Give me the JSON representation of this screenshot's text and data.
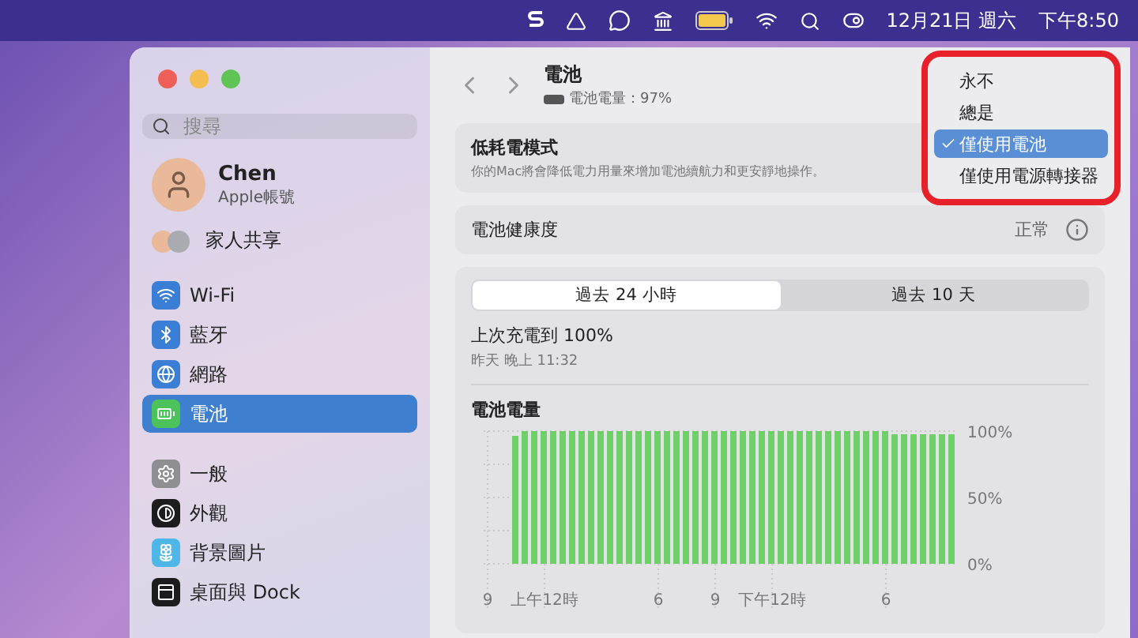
{
  "menu_bar": {
    "icons": [
      {
        "kind": "s"
      },
      {
        "kind": "drive"
      },
      {
        "kind": "line"
      },
      {
        "kind": "bank"
      },
      {
        "kind": "battery"
      },
      {
        "kind": "wifi"
      },
      {
        "kind": "search"
      },
      {
        "kind": "control"
      }
    ],
    "date": "12月21日 週六",
    "time": "下午8:50"
  },
  "sidebar": {
    "search": {
      "placeholder": "搜尋"
    },
    "account": {
      "name": "Chen",
      "subtitle": "Apple帳號"
    },
    "family": "家人共享",
    "groups": [
      [
        {
          "label": "Wi-Fi",
          "kind": "wifi",
          "color": "#3a7fd5",
          "selected": false
        },
        {
          "label": "藍牙",
          "kind": "bluetooth",
          "color": "#3a7fd5",
          "selected": false
        },
        {
          "label": "網路",
          "kind": "network",
          "color": "#3a7fd5",
          "selected": false
        },
        {
          "label": "電池",
          "kind": "battery",
          "color": "#4cc25a",
          "selected": true
        }
      ],
      [
        {
          "label": "一般",
          "kind": "general",
          "color": "#8e8e93",
          "selected": false
        },
        {
          "label": "外觀",
          "kind": "appearance",
          "color": "#1c1c1e",
          "selected": false
        },
        {
          "label": "背景圖片",
          "kind": "wallpaper",
          "color": "#4fb6e8",
          "selected": false
        },
        {
          "label": "桌面與 Dock",
          "kind": "desktop",
          "color": "#1c1c1e",
          "selected": false
        }
      ]
    ]
  },
  "header": {
    "title": "電池",
    "subtitle": "電池電量：97%"
  },
  "low_power": {
    "title": "低耗電模式",
    "description": "你的Mac將會降低電力用量來增加電池續航力和更安靜地操作。",
    "menu": [
      {
        "label": "永不",
        "selected": false
      },
      {
        "label": "總是",
        "selected": false
      },
      {
        "label": "僅使用電池",
        "selected": true
      },
      {
        "label": "僅使用電源轉接器",
        "selected": false
      }
    ]
  },
  "health": {
    "label": "電池健康度",
    "value": "正常"
  },
  "tabs": [
    {
      "label": "過去 24 小時",
      "selected": true
    },
    {
      "label": "過去 10 天",
      "selected": false
    }
  ],
  "last_charge": {
    "title": "上次充電到 100%",
    "time": "昨天 晚上 11:32"
  },
  "chart": {
    "chart_data": {
      "type": "bar",
      "title": "電池電量",
      "ylim": [
        0,
        100
      ],
      "grid": true,
      "yticks": [
        {
          "value": 0,
          "label": "0%"
        },
        {
          "value": 50,
          "label": "50%"
        },
        {
          "value": 100,
          "label": "100%"
        }
      ],
      "categories": [
        "9",
        null,
        null,
        null,
        null,
        null,
        "上午12時",
        null,
        null,
        null,
        null,
        null,
        null,
        null,
        null,
        null,
        null,
        null,
        "6",
        null,
        null,
        null,
        null,
        null,
        "9",
        null,
        null,
        null,
        null,
        null,
        "下午12時",
        null,
        null,
        null,
        null,
        null,
        null,
        null,
        null,
        null,
        null,
        null,
        "6",
        null,
        null,
        null,
        null,
        null,
        null,
        null
      ],
      "values": [
        null,
        null,
        null,
        97,
        100,
        100,
        100,
        100,
        100,
        100,
        100,
        100,
        100,
        100,
        100,
        100,
        100,
        100,
        100,
        100,
        100,
        100,
        100,
        100,
        100,
        100,
        100,
        100,
        100,
        100,
        100,
        100,
        100,
        100,
        100,
        100,
        100,
        100,
        100,
        100,
        100,
        100,
        100,
        98,
        98,
        98,
        98,
        98,
        98,
        98
      ]
    }
  }
}
